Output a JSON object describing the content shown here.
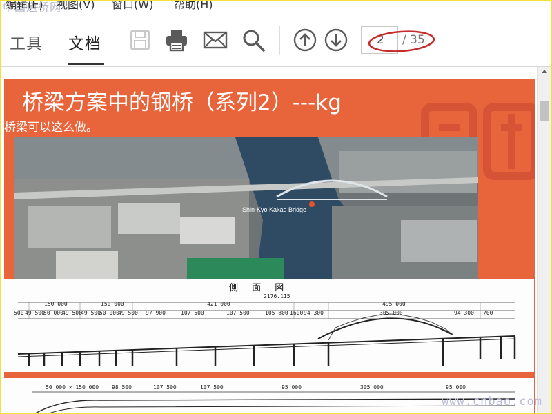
{
  "menu": {
    "watermark": "中国道桥网",
    "items": [
      "编辑(E)",
      "视图(V)",
      "窗口(W)",
      "帮助(H)"
    ]
  },
  "toolbar": {
    "tabs": [
      "工具",
      "文档"
    ],
    "active_tab": "文档",
    "buttons": [
      {
        "name": "save-icon",
        "enabled": false
      },
      {
        "name": "print-icon",
        "enabled": true
      },
      {
        "name": "mail-icon",
        "enabled": true
      },
      {
        "name": "search-icon",
        "enabled": true
      },
      {
        "name": "page-up-icon",
        "enabled": true
      },
      {
        "name": "page-down-icon",
        "enabled": true
      }
    ],
    "page_current": "2",
    "page_total": "/ 35"
  },
  "slide": {
    "title": "桥梁方案中的钢桥（系列2）---kg",
    "subtitle": "桥梁可以这么做。",
    "photo_label": "Shin-Kyo Kakao Bridge",
    "drawing_title": "側 面 図",
    "dims_top": [
      "2176.115",
      "150 000",
      "150 000",
      "421 000",
      "495 000"
    ],
    "dims_row2": [
      "500",
      "49 500",
      "50 000",
      "49 500",
      "49 500",
      "50 000",
      "49 500",
      "97 900",
      "107 500",
      "107 500",
      "105 800",
      "1600",
      "94 300",
      "305 000",
      "94 300",
      "700"
    ],
    "dims_lower": [
      "50 000 × 150 000",
      "98 500",
      "107 500",
      "107 500",
      "95 000",
      "305 000",
      "95 000"
    ]
  },
  "watermark_bottom": "www.cnbao.com",
  "colors": {
    "slide_bg": "#e8653c",
    "frame_border": "#f2e13a",
    "annotation": "#c62b2b"
  }
}
